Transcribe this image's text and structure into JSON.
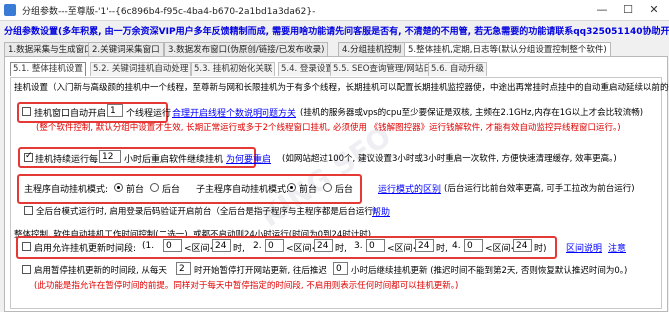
{
  "window": {
    "title": "分组参数---至尊版-'1'--{6c896b4-f95c-4ba4-b670-2a1bd1a3da62}-",
    "controls": [
      "—",
      "☐",
      "✕"
    ]
  },
  "notice": "分组参数设置(多年积累, 由一万余资深VIP用户多年反馈精制而成, 需要用啥功能请先问客服是否有, 不清楚的不用管, 若无急需要的功能请联系qq325051140协助开发)",
  "main_tabs": [
    "1.数据采集与生成窗口",
    "2.关键词采集窗口",
    "3.数据发布窗口(伪原创/链接/已发布收录)",
    "4.分组挂机控制",
    "5.整体挂机,定期,日志等(默认分组设置控制整个软件)"
  ],
  "sub_tabs": [
    "5.1. 整体挂机设置",
    "5.2. 关键词挂机自动处理",
    "5.3. 挂机初始化关联",
    "5.4. 登录设置",
    "5.5. SEO查询管理/网站日",
    "5.6. 自动升级"
  ],
  "section": {
    "intro": "挂机设置（入门新与高级颜的挂机中一个线程，至尊新与网和长限挂机为于有多个线程，长期挂机可以配置长期挂机监控器使，中途出再常挂时点挂中的自动重启动延续以前的任务）",
    "row1": {
      "checkbox_label": "挂机窗口自动开启",
      "value": "1",
      "unit": "个线程运行",
      "link": "合理开启线程个数说明",
      "link2": "问题方关",
      "desc": "(挂机的服务器或vps的cpu至少要保证是双核, 主频在2.1GHz,内存在1G以上才会比较流畅)",
      "warn": "(整个软件控制, 默认分组中设置才生效, 长期正常运行或多于2个线程窗口挂机, 必须使用 《钱解图控器》运行钱解软件, 才能有效自动监控异线程窗口运行。)"
    },
    "row2": {
      "checkbox_label": "挂机持续运行每",
      "value": "12",
      "unit": "小时后重启软件继续挂机",
      "link": "为何要重启",
      "desc": "(如网站超过100个, 建议设置3小时或3小时重启一次软件, 方便快速清理缓存, 效率更高。)"
    },
    "row3": {
      "label": "主程序自动挂机模式:",
      "options": [
        "前台",
        "后台"
      ],
      "selected": 0,
      "label2": "子主程序自动挂机模式:",
      "options2": [
        "前台",
        "后台"
      ],
      "selected2": 0,
      "link": "运行模式的区别",
      "desc": "(后台运行比前台效率更高, 可手工拉改为前台运行)"
    },
    "row4": {
      "checkbox_label": "全后台模式运行时, 启用登录后码验证开启前台（全后台是指子程序与主程序都是后台运行）",
      "link": "帮助"
    },
    "group_title": "整体控制, 软件自动挂机工作时间控制(二选一), 或都不启动则24小时运行(时间为0到24时计时)",
    "row5": {
      "checkbox_label": "启用允许挂机更新时间段:",
      "ranges": [
        {
          "idx": "(1.",
          "from": "0",
          "to": "24"
        },
        {
          "idx": "2.",
          "from": "0",
          "to": "24"
        },
        {
          "idx": "3.",
          "from": "0",
          "to": "24"
        },
        {
          "idx": "4.",
          "from": "0",
          "to": "24"
        }
      ],
      "range_sep": "<区间<",
      "hour_unit": "时,",
      "close": "时)",
      "link": "区间说明",
      "link2": "注意"
    },
    "row6": {
      "checkbox_label": "启用暂停挂机更新的时间段, 从每天",
      "value": "2",
      "mid": "时开始暂停打开网站更新, 往后推迟",
      "value2": "0",
      "tail": "小时后继续挂机更新 (推迟时间不能到第2天, 否则恢复默认推迟时间为0。)",
      "warn": "(此功能是指允许在暂停时间的前提。同样对于每天中暂停指定的时间段, 不启用则表示任何时间都可以挂机更新。)"
    }
  },
  "watermark": "KING SEO"
}
